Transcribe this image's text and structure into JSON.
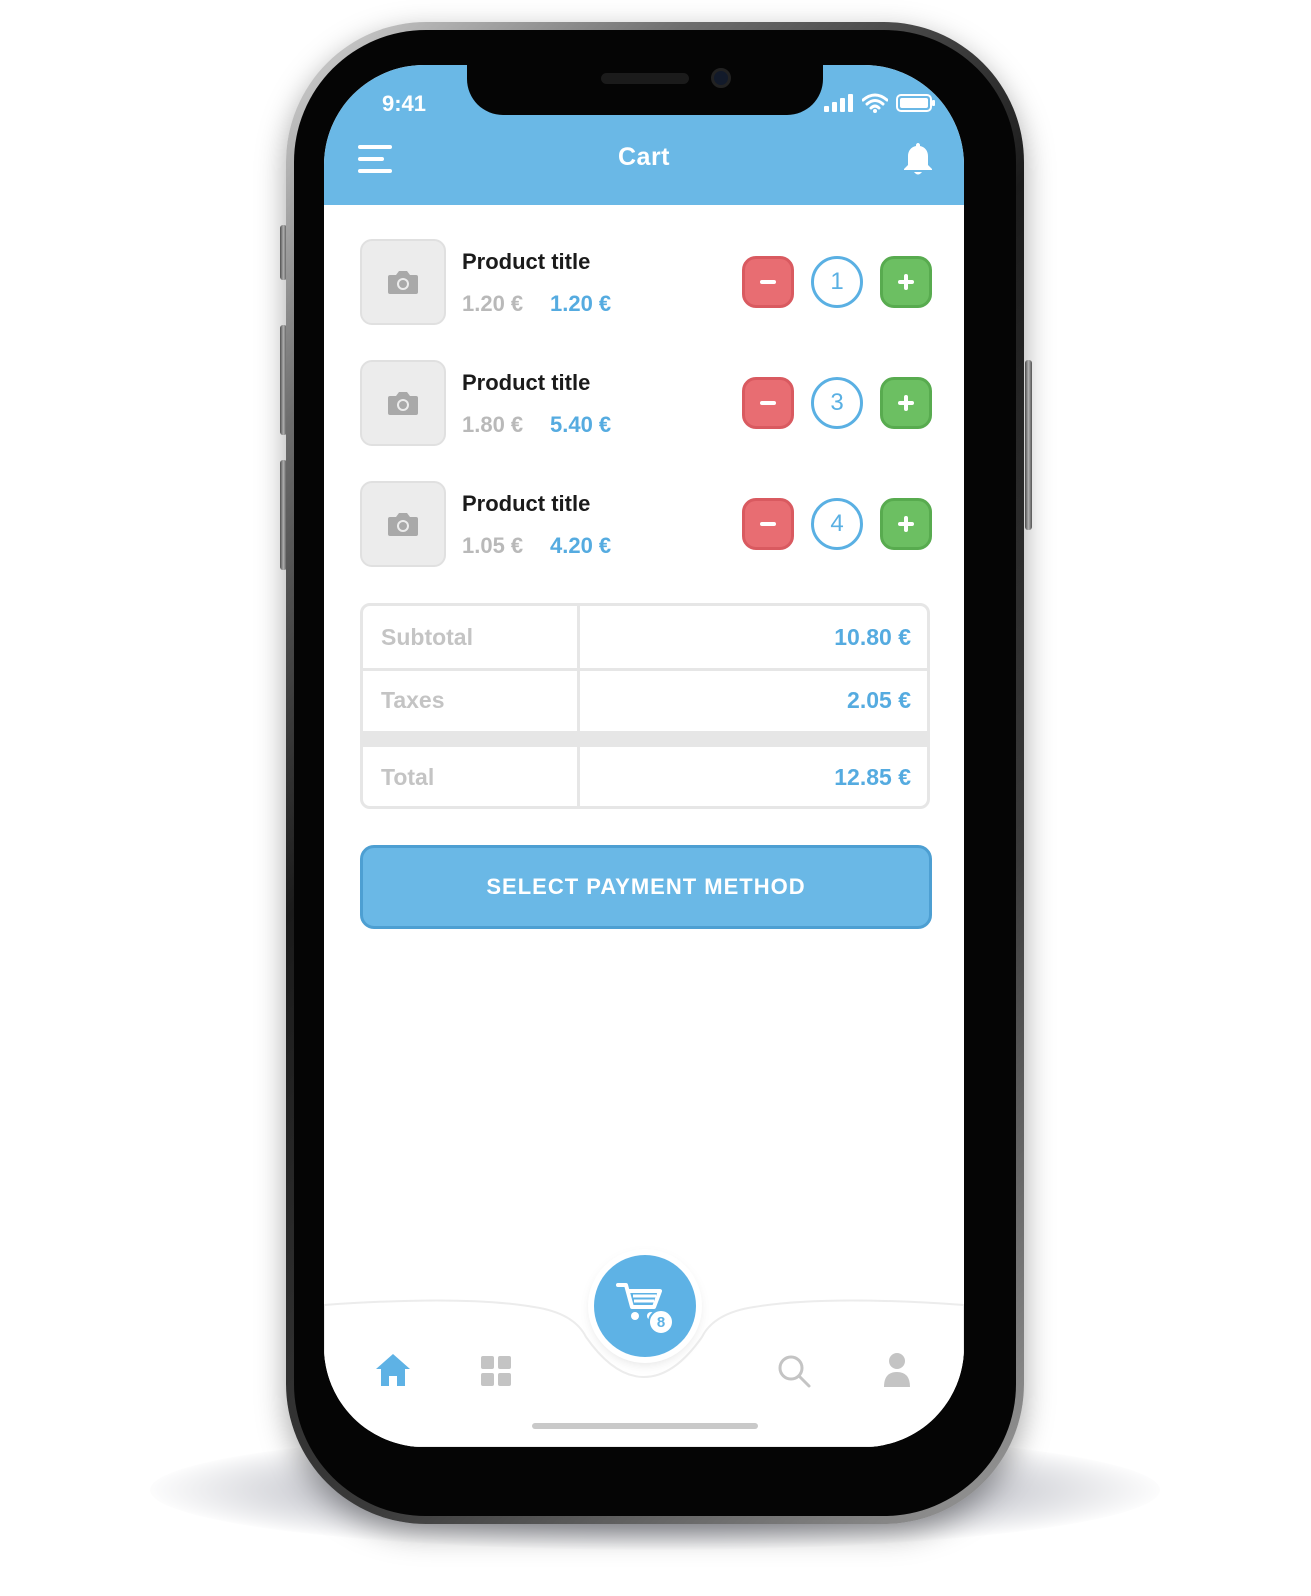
{
  "status_bar": {
    "time": "9:41"
  },
  "header": {
    "title": "Cart"
  },
  "cart": {
    "items": [
      {
        "title": "Product title",
        "unit_price": "1.20 €",
        "line_total": "1.20 €",
        "quantity": "1"
      },
      {
        "title": "Product title",
        "unit_price": "1.80 €",
        "line_total": "5.40 €",
        "quantity": "3"
      },
      {
        "title": "Product title",
        "unit_price": "1.05 €",
        "line_total": "4.20 €",
        "quantity": "4"
      }
    ]
  },
  "summary": {
    "subtotal_label": "Subtotal",
    "subtotal_value": "10.80 €",
    "taxes_label": "Taxes",
    "taxes_value": "2.05 €",
    "total_label": "Total",
    "total_value": "12.85 €"
  },
  "actions": {
    "payment_button": "SELECT PAYMENT METHOD"
  },
  "bottom_nav": {
    "cart_count": "8",
    "active_tab": "home"
  },
  "colors": {
    "primary": "#6ab8e6",
    "price_accent": "#55abe0",
    "decrement": "#e86d72",
    "increment": "#6cbf62",
    "muted_text": "#b9b9b9"
  },
  "icons": [
    "menu-icon",
    "bell-icon",
    "camera-icon",
    "minus-icon",
    "plus-icon",
    "home-icon",
    "grid-icon",
    "cart-icon",
    "search-icon",
    "user-icon"
  ]
}
